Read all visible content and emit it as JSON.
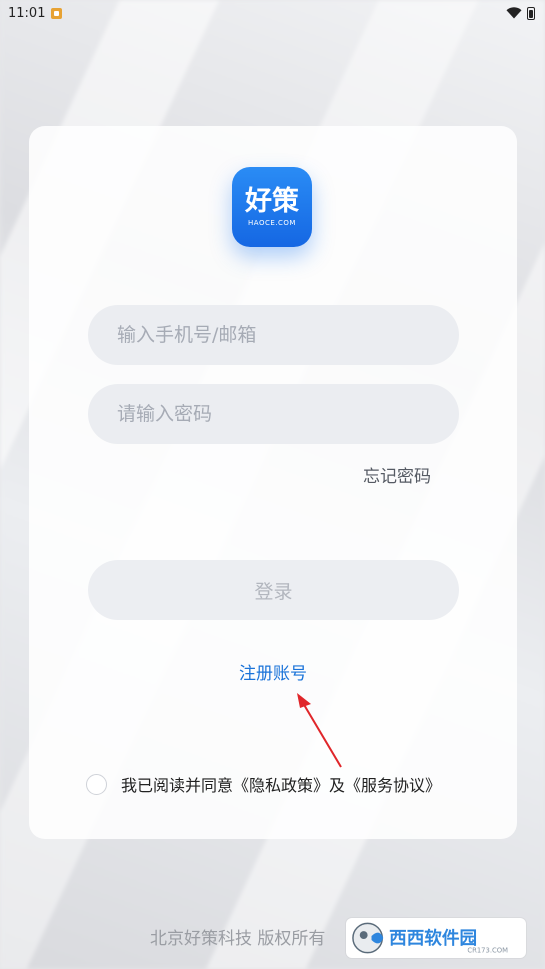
{
  "status_bar": {
    "time": "11:01"
  },
  "logo": {
    "cn_text": "好策",
    "en_text": "HAOCE.COM"
  },
  "form": {
    "phone_placeholder": "输入手机号/邮箱",
    "password_placeholder": "请输入密码",
    "forgot_label": "忘记密码",
    "login_label": "登录",
    "register_label": "注册账号",
    "agreement_text": "我已阅读并同意《隐私政策》及《服务协议》"
  },
  "footer": {
    "copyright": "北京好策科技 版权所有"
  },
  "watermark": {
    "cn_text": "西西软件园",
    "en_text": "CR173.COM"
  },
  "colors": {
    "accent": "#1a73d9",
    "logo_blue": "#1567e3",
    "annotation_arrow": "#e0262a"
  }
}
